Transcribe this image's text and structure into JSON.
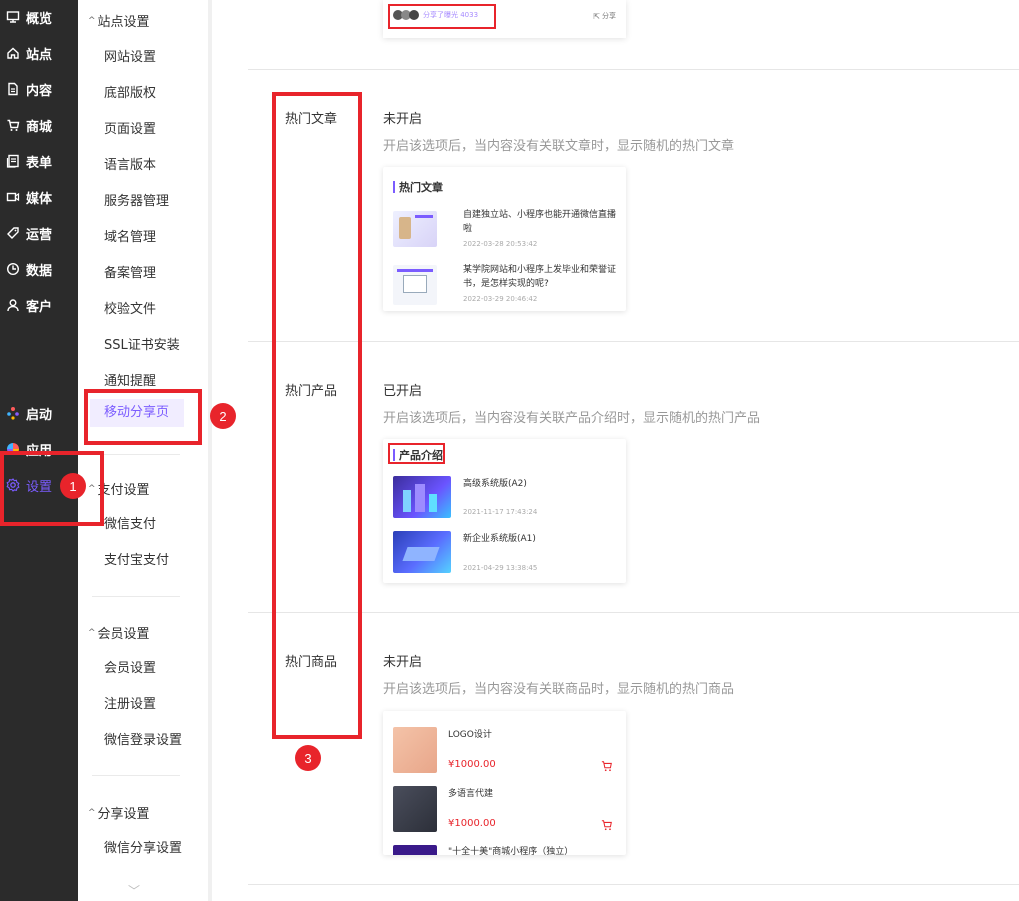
{
  "nav": {
    "items": [
      {
        "label": "概览",
        "icon": "monitor-icon"
      },
      {
        "label": "站点",
        "icon": "home-icon"
      },
      {
        "label": "内容",
        "icon": "document-icon"
      },
      {
        "label": "商城",
        "icon": "cart-icon"
      },
      {
        "label": "表单",
        "icon": "form-icon"
      },
      {
        "label": "媒体",
        "icon": "media-icon"
      },
      {
        "label": "运营",
        "icon": "tag-icon"
      },
      {
        "label": "数据",
        "icon": "chart-pie-icon"
      },
      {
        "label": "客户",
        "icon": "user-icon"
      }
    ],
    "launch": "启动",
    "apps": "应用",
    "settings": "设置"
  },
  "submenu": {
    "site_group": "站点设置",
    "site_items": [
      "网站设置",
      "底部版权",
      "页面设置",
      "语言版本",
      "服务器管理",
      "域名管理",
      "备案管理",
      "校验文件",
      "SSL证书安装",
      "通知提醒",
      "移动分享页"
    ],
    "pay_group": "支付设置",
    "pay_items": [
      "微信支付",
      "支付宝支付"
    ],
    "member_group": "会员设置",
    "member_items": [
      "会员设置",
      "注册设置",
      "微信登录设置"
    ],
    "share_group": "分享设置",
    "share_items": [
      "微信分享设置"
    ]
  },
  "share_top": {
    "text": "分享了曝光 4033",
    "share": "分享"
  },
  "sections": [
    {
      "label": "热门文章",
      "status": "未开启",
      "desc": "开启该选项后，当内容没有关联文章时，显示随机的热门文章",
      "card_title": "热门文章",
      "items": [
        {
          "title": "自建独立站、小程序也能开通微信直播啦",
          "date": "2022-03-28 20:53:42"
        },
        {
          "title": "某学院网站和小程序上发毕业和荣誉证书，是怎样实现的呢?",
          "date": "2022-03-29 20:46:42"
        }
      ]
    },
    {
      "label": "热门产品",
      "status": "已开启",
      "desc": "开启该选项后，当内容没有关联产品介绍时，显示随机的热门产品",
      "card_title": "产品介绍",
      "items": [
        {
          "title": "高级系统版(A2)",
          "date": "2021-11-17 17:43:24"
        },
        {
          "title": "新企业系统版(A1)",
          "date": "2021-04-29 13:38:45"
        }
      ]
    },
    {
      "label": "热门商品",
      "status": "未开启",
      "desc": "开启该选项后，当内容没有关联商品时，显示随机的热门商品",
      "items": [
        {
          "title": "LOGO设计",
          "price": "¥1000.00"
        },
        {
          "title": "多语言代建",
          "price": "¥1000.00"
        },
        {
          "title": "\"十全十美\"商城小程序（独立）",
          "price": ""
        }
      ]
    }
  ],
  "badges": [
    "1",
    "2",
    "3"
  ],
  "colors": {
    "accent": "#7b5cff",
    "annotation_red": "#e8242b",
    "price_red": "#e8242b"
  }
}
